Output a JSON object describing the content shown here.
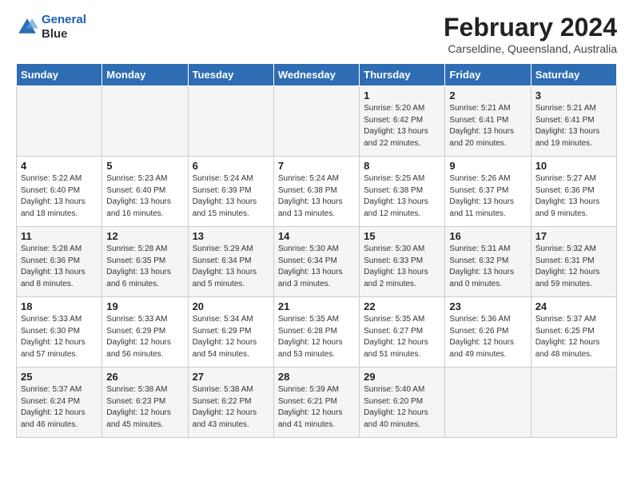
{
  "logo": {
    "line1": "General",
    "line2": "Blue"
  },
  "title": "February 2024",
  "subtitle": "Carseldine, Queensland, Australia",
  "headers": [
    "Sunday",
    "Monday",
    "Tuesday",
    "Wednesday",
    "Thursday",
    "Friday",
    "Saturday"
  ],
  "weeks": [
    [
      {
        "day": "",
        "info": ""
      },
      {
        "day": "",
        "info": ""
      },
      {
        "day": "",
        "info": ""
      },
      {
        "day": "",
        "info": ""
      },
      {
        "day": "1",
        "info": "Sunrise: 5:20 AM\nSunset: 6:42 PM\nDaylight: 13 hours\nand 22 minutes."
      },
      {
        "day": "2",
        "info": "Sunrise: 5:21 AM\nSunset: 6:41 PM\nDaylight: 13 hours\nand 20 minutes."
      },
      {
        "day": "3",
        "info": "Sunrise: 5:21 AM\nSunset: 6:41 PM\nDaylight: 13 hours\nand 19 minutes."
      }
    ],
    [
      {
        "day": "4",
        "info": "Sunrise: 5:22 AM\nSunset: 6:40 PM\nDaylight: 13 hours\nand 18 minutes."
      },
      {
        "day": "5",
        "info": "Sunrise: 5:23 AM\nSunset: 6:40 PM\nDaylight: 13 hours\nand 16 minutes."
      },
      {
        "day": "6",
        "info": "Sunrise: 5:24 AM\nSunset: 6:39 PM\nDaylight: 13 hours\nand 15 minutes."
      },
      {
        "day": "7",
        "info": "Sunrise: 5:24 AM\nSunset: 6:38 PM\nDaylight: 13 hours\nand 13 minutes."
      },
      {
        "day": "8",
        "info": "Sunrise: 5:25 AM\nSunset: 6:38 PM\nDaylight: 13 hours\nand 12 minutes."
      },
      {
        "day": "9",
        "info": "Sunrise: 5:26 AM\nSunset: 6:37 PM\nDaylight: 13 hours\nand 11 minutes."
      },
      {
        "day": "10",
        "info": "Sunrise: 5:27 AM\nSunset: 6:36 PM\nDaylight: 13 hours\nand 9 minutes."
      }
    ],
    [
      {
        "day": "11",
        "info": "Sunrise: 5:28 AM\nSunset: 6:36 PM\nDaylight: 13 hours\nand 8 minutes."
      },
      {
        "day": "12",
        "info": "Sunrise: 5:28 AM\nSunset: 6:35 PM\nDaylight: 13 hours\nand 6 minutes."
      },
      {
        "day": "13",
        "info": "Sunrise: 5:29 AM\nSunset: 6:34 PM\nDaylight: 13 hours\nand 5 minutes."
      },
      {
        "day": "14",
        "info": "Sunrise: 5:30 AM\nSunset: 6:34 PM\nDaylight: 13 hours\nand 3 minutes."
      },
      {
        "day": "15",
        "info": "Sunrise: 5:30 AM\nSunset: 6:33 PM\nDaylight: 13 hours\nand 2 minutes."
      },
      {
        "day": "16",
        "info": "Sunrise: 5:31 AM\nSunset: 6:32 PM\nDaylight: 13 hours\nand 0 minutes."
      },
      {
        "day": "17",
        "info": "Sunrise: 5:32 AM\nSunset: 6:31 PM\nDaylight: 12 hours\nand 59 minutes."
      }
    ],
    [
      {
        "day": "18",
        "info": "Sunrise: 5:33 AM\nSunset: 6:30 PM\nDaylight: 12 hours\nand 57 minutes."
      },
      {
        "day": "19",
        "info": "Sunrise: 5:33 AM\nSunset: 6:29 PM\nDaylight: 12 hours\nand 56 minutes."
      },
      {
        "day": "20",
        "info": "Sunrise: 5:34 AM\nSunset: 6:29 PM\nDaylight: 12 hours\nand 54 minutes."
      },
      {
        "day": "21",
        "info": "Sunrise: 5:35 AM\nSunset: 6:28 PM\nDaylight: 12 hours\nand 53 minutes."
      },
      {
        "day": "22",
        "info": "Sunrise: 5:35 AM\nSunset: 6:27 PM\nDaylight: 12 hours\nand 51 minutes."
      },
      {
        "day": "23",
        "info": "Sunrise: 5:36 AM\nSunset: 6:26 PM\nDaylight: 12 hours\nand 49 minutes."
      },
      {
        "day": "24",
        "info": "Sunrise: 5:37 AM\nSunset: 6:25 PM\nDaylight: 12 hours\nand 48 minutes."
      }
    ],
    [
      {
        "day": "25",
        "info": "Sunrise: 5:37 AM\nSunset: 6:24 PM\nDaylight: 12 hours\nand 46 minutes."
      },
      {
        "day": "26",
        "info": "Sunrise: 5:38 AM\nSunset: 6:23 PM\nDaylight: 12 hours\nand 45 minutes."
      },
      {
        "day": "27",
        "info": "Sunrise: 5:38 AM\nSunset: 6:22 PM\nDaylight: 12 hours\nand 43 minutes."
      },
      {
        "day": "28",
        "info": "Sunrise: 5:39 AM\nSunset: 6:21 PM\nDaylight: 12 hours\nand 41 minutes."
      },
      {
        "day": "29",
        "info": "Sunrise: 5:40 AM\nSunset: 6:20 PM\nDaylight: 12 hours\nand 40 minutes."
      },
      {
        "day": "",
        "info": ""
      },
      {
        "day": "",
        "info": ""
      }
    ]
  ]
}
